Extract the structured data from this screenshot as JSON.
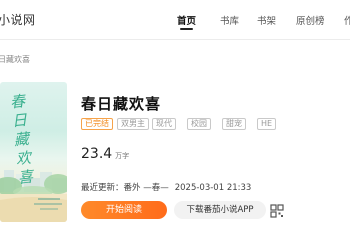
{
  "header": {
    "brand": "小说网",
    "nav": [
      {
        "label": "首页",
        "active": true
      },
      {
        "label": "书库",
        "active": false
      },
      {
        "label": "书架",
        "active": false
      },
      {
        "label": "原创榜",
        "active": false
      },
      {
        "label": "作",
        "active": false
      }
    ]
  },
  "breadcrumb": "日藏欢喜",
  "book": {
    "cover_title": "春日藏欢喜",
    "title": "春日藏欢喜",
    "tags": [
      "已完结",
      "双男主",
      "现代",
      "校园",
      "甜宠",
      "HE"
    ],
    "word_count": "23.4",
    "word_unit": "万字",
    "update_label": "最近更新：",
    "update_chapter": "番外 —春—",
    "update_time": "2025-03-01 21:33"
  },
  "actions": {
    "read_label": "开始阅读",
    "app_label": "下载番茄小说APP"
  },
  "colors": {
    "accent": "#ff7a22",
    "tag_status": "#f28a1c",
    "cover_text": "#3bb08f"
  }
}
